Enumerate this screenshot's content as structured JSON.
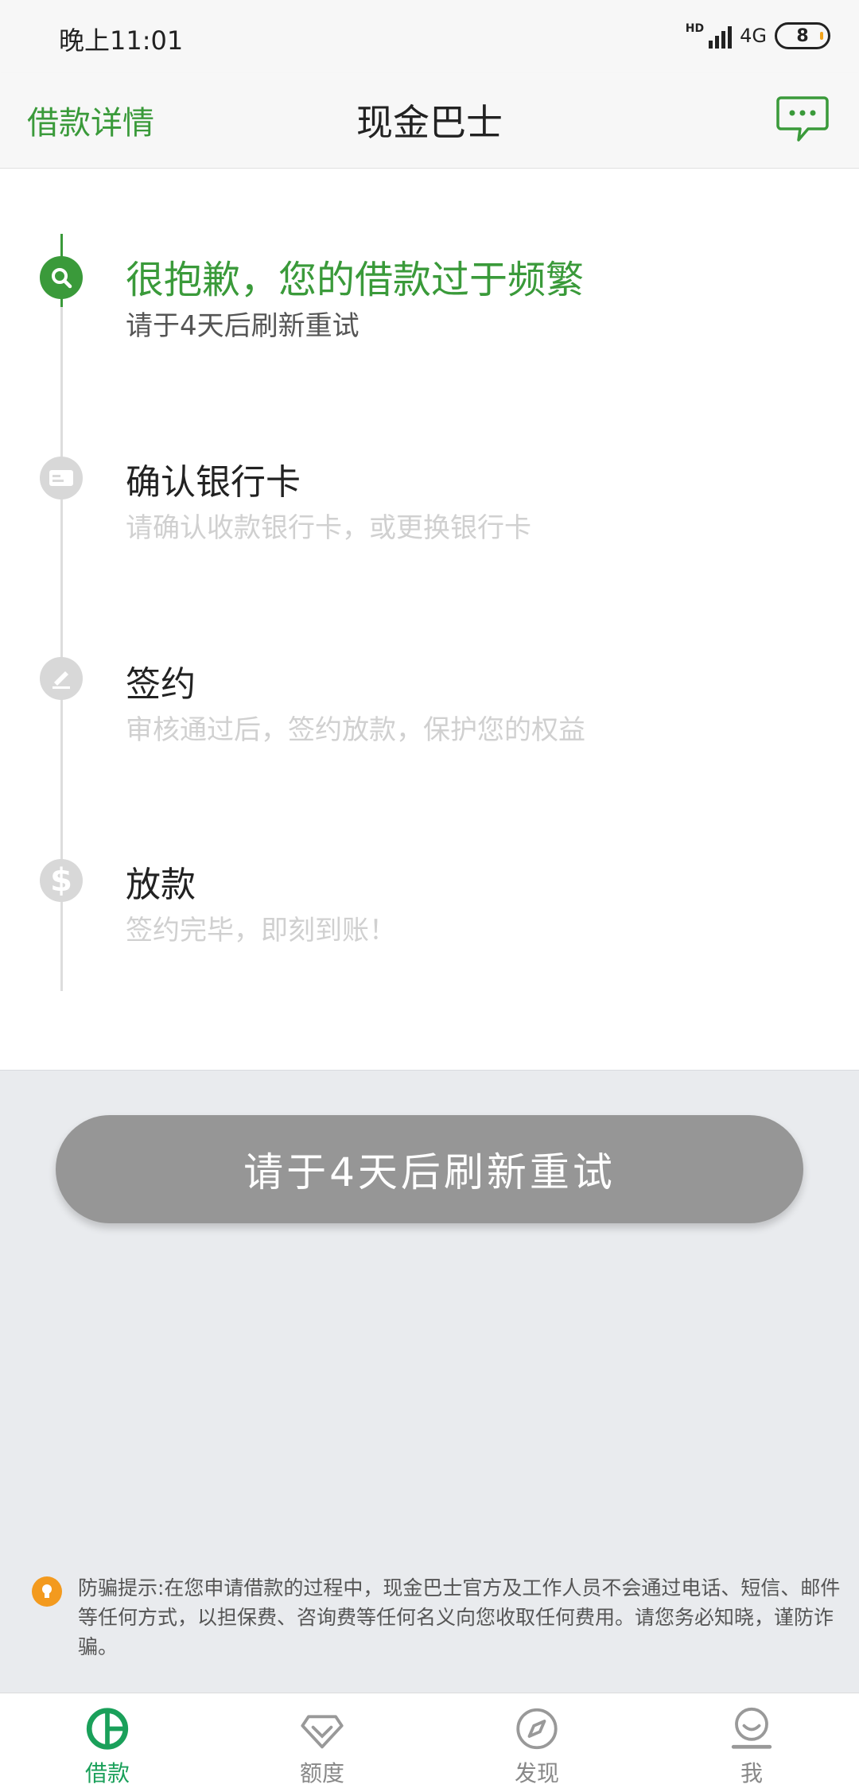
{
  "status_bar": {
    "time": "晚上11:01",
    "hd": "HD",
    "network": "4G",
    "battery": "8"
  },
  "header": {
    "back_label": "借款详情",
    "title": "现金巴士"
  },
  "colors": {
    "accent_green": "#3a9a3a",
    "nav_green": "#1aa05a",
    "inactive_gray": "#d8d8d8",
    "button_gray": "#969696",
    "warning_orange": "#f39a1e"
  },
  "steps": [
    {
      "title": "很抱歉，您的借款过于频繁",
      "desc": "请于4天后刷新重试",
      "icon": "search-icon",
      "state": "active"
    },
    {
      "title": "确认银行卡",
      "desc": "请确认收款银行卡，或更换银行卡",
      "icon": "card-icon",
      "state": "pending"
    },
    {
      "title": "签约",
      "desc": "审核通过后，签约放款，保护您的权益",
      "icon": "sign-icon",
      "state": "pending"
    },
    {
      "title": "放款",
      "desc": "签约完毕，即刻到账！",
      "icon": "dollar-icon",
      "state": "pending"
    }
  ],
  "action_button": "请于4天后刷新重试",
  "warning": {
    "icon": "lightbulb-icon",
    "text": "防骗提示:在您申请借款的过程中，现金巴士官方及工作人员不会通过电话、短信、邮件等任何方式，以担保费、咨询费等任何名义向您收取任何费用。请您务必知晓，谨防诈骗。"
  },
  "bottom_nav": [
    {
      "label": "借款",
      "icon": "loan-icon",
      "active": true
    },
    {
      "label": "额度",
      "icon": "diamond-icon",
      "active": false
    },
    {
      "label": "发现",
      "icon": "compass-icon",
      "active": false
    },
    {
      "label": "我",
      "icon": "profile-icon",
      "active": false
    }
  ]
}
